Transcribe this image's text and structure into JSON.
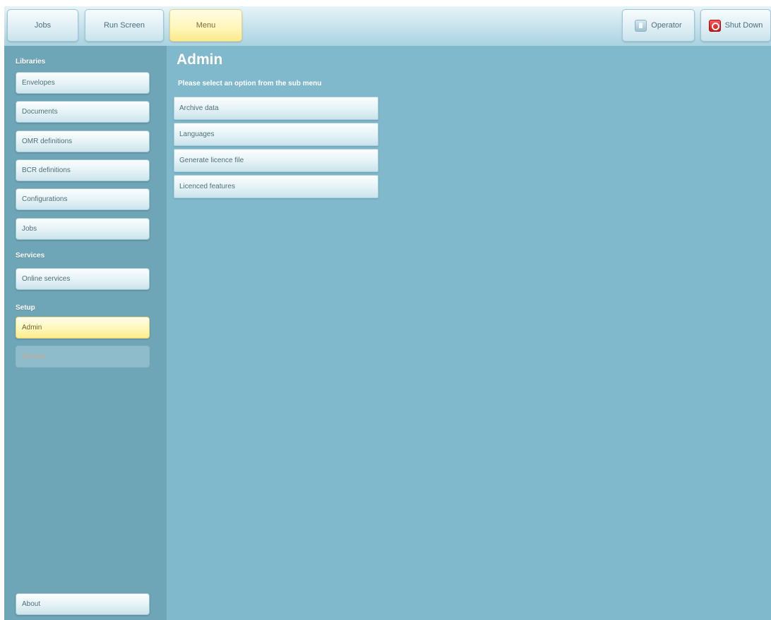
{
  "topbar": {
    "jobs_label": "Jobs",
    "run_screen_label": "Run Screen",
    "menu_label": "Menu",
    "operator_label": "Operator",
    "operator_icon": "operator-icon",
    "shutdown_label": "Shut Down",
    "shutdown_icon": "power-icon"
  },
  "sidebar": {
    "libraries_label": "Libraries",
    "libraries": [
      {
        "label": "Envelopes"
      },
      {
        "label": "Documents"
      },
      {
        "label": "OMR definitions"
      },
      {
        "label": "BCR definitions"
      },
      {
        "label": "Configurations"
      },
      {
        "label": "Jobs"
      }
    ],
    "services_label": "Services",
    "services": [
      {
        "label": "Online services"
      }
    ],
    "setup_label": "Setup",
    "setup": [
      {
        "label": "Admin",
        "state": "selected"
      },
      {
        "label": "Service",
        "state": "disabled"
      }
    ],
    "about_label": "About"
  },
  "main": {
    "title": "Admin",
    "subtitle": "Please select an option from the sub menu",
    "options": [
      {
        "label": "Archive data"
      },
      {
        "label": "Languages"
      },
      {
        "label": "Generate licence file"
      },
      {
        "label": "Licenced features"
      }
    ]
  },
  "colors": {
    "sidebar_bg": "#6ea5b7",
    "main_bg": "#80b8cc",
    "selected_yellow": "#fff7b9",
    "shutdown_red": "#d8181e"
  }
}
